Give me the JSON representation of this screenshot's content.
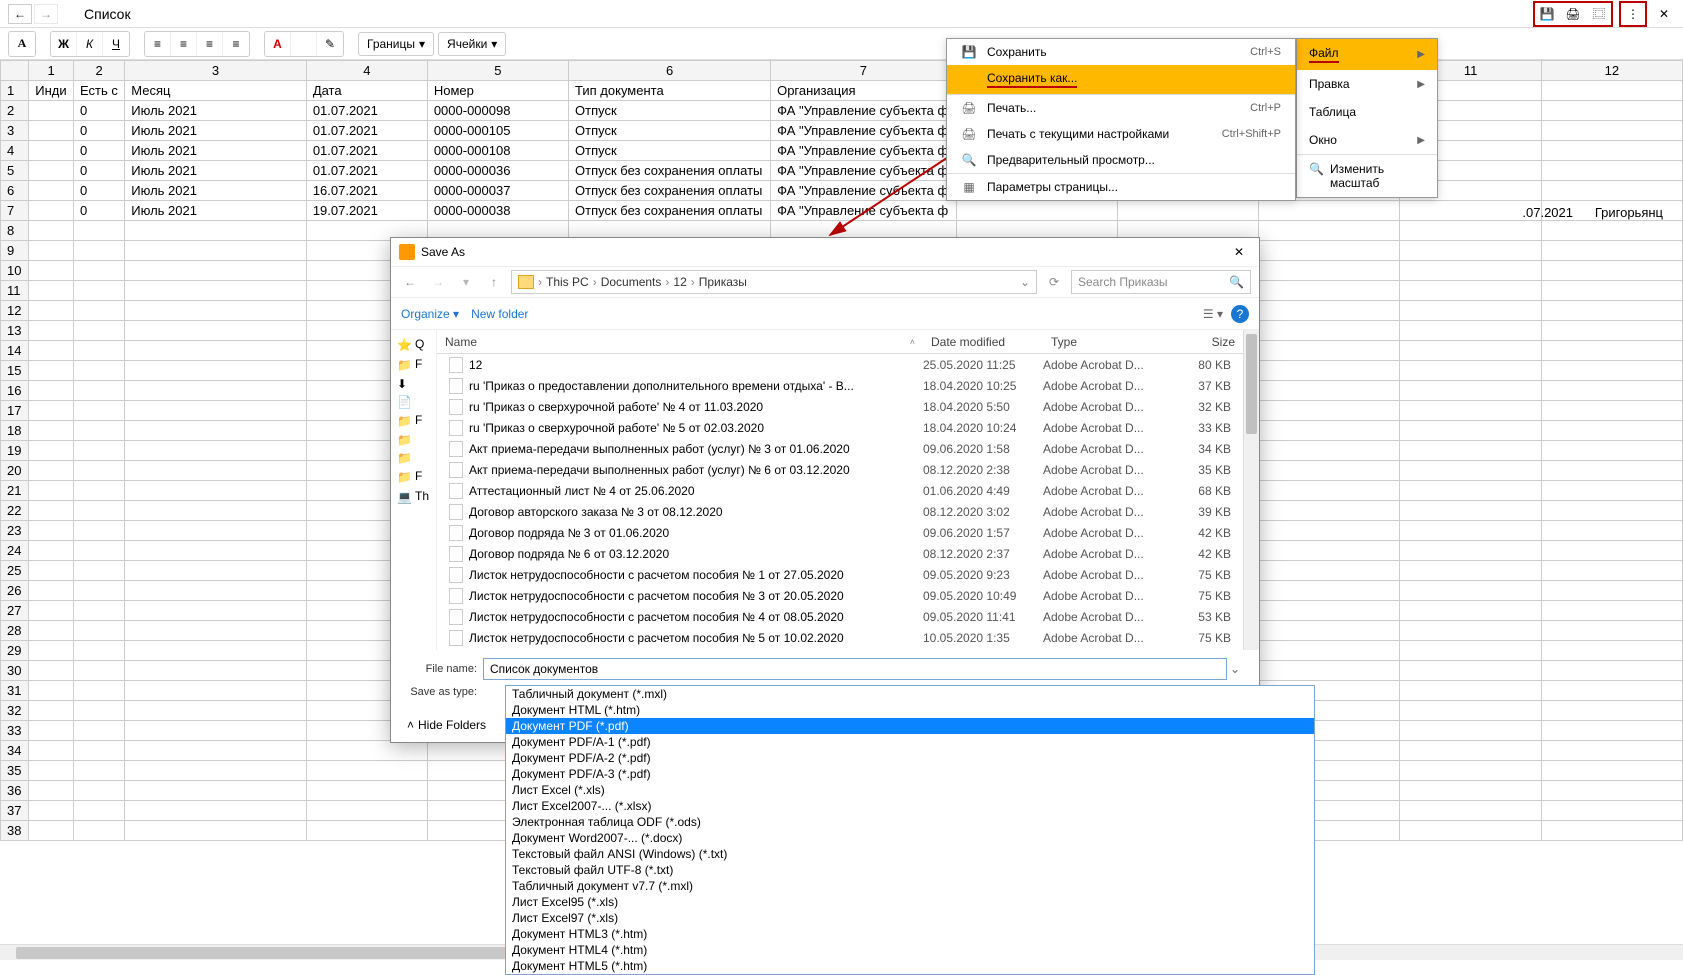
{
  "title": "Список",
  "topRightExtra1": ".07.2021",
  "topRightExtra2": "Григорьянц",
  "toolbar": {
    "font_label": "А",
    "bold": "Ж",
    "italic": "К",
    "underline": "Ч",
    "borders_label": "Границы",
    "cells_label": "Ячейки"
  },
  "mainMenu": {
    "file": "Файл",
    "edit": "Правка",
    "table": "Таблица",
    "window": "Окно",
    "zoom": "Изменить масштаб"
  },
  "fileMenu": {
    "save": "Сохранить",
    "save_sc": "Ctrl+S",
    "saveas": "Сохранить как...",
    "print": "Печать...",
    "print_sc": "Ctrl+P",
    "print_current": "Печать с текущими настройками",
    "print_current_sc": "Ctrl+Shift+P",
    "preview": "Предварительный просмотр...",
    "page_setup": "Параметры страницы..."
  },
  "sheet": {
    "headers": [
      "Инди",
      "Есть с",
      "Месяц",
      "Дата",
      "Номер",
      "Тип документа",
      "Организация"
    ],
    "rows": [
      [
        "",
        "0",
        "Июль 2021",
        "01.07.2021",
        "0000-000098",
        "Отпуск",
        "ФА \"Управление субъекта ф"
      ],
      [
        "",
        "0",
        "Июль 2021",
        "01.07.2021",
        "0000-000105",
        "Отпуск",
        "ФА \"Управление субъекта ф"
      ],
      [
        "",
        "0",
        "Июль 2021",
        "01.07.2021",
        "0000-000108",
        "Отпуск",
        "ФА \"Управление субъекта ф"
      ],
      [
        "",
        "0",
        "Июль 2021",
        "01.07.2021",
        "0000-000036",
        "Отпуск без сохранения оплаты",
        "ФА \"Управление субъекта ф"
      ],
      [
        "",
        "0",
        "Июль 2021",
        "16.07.2021",
        "0000-000037",
        "Отпуск без сохранения оплаты",
        "ФА \"Управление субъекта ф"
      ],
      [
        "",
        "0",
        "Июль 2021",
        "19.07.2021",
        "0000-000038",
        "Отпуск без сохранения оплаты",
        "ФА \"Управление субъекта ф"
      ]
    ]
  },
  "saveDialog": {
    "title": "Save As",
    "path": [
      "This PC",
      "Documents",
      "12",
      "Приказы"
    ],
    "search_ph": "Search Приказы",
    "organize": "Organize",
    "new_folder": "New folder",
    "cols": {
      "name": "Name",
      "date": "Date modified",
      "type": "Type",
      "size": "Size"
    },
    "files": [
      {
        "name": "12",
        "date": "25.05.2020 11:25",
        "type": "Adobe Acrobat D...",
        "size": "80 KB"
      },
      {
        "name": "ru 'Приказ о предоставлении дополнительного времени отдыха' - В...",
        "date": "18.04.2020 10:25",
        "type": "Adobe Acrobat D...",
        "size": "37 KB"
      },
      {
        "name": "ru 'Приказ о сверхурочной работе' № 4 от 11.03.2020",
        "date": "18.04.2020 5:50",
        "type": "Adobe Acrobat D...",
        "size": "32 KB"
      },
      {
        "name": "ru 'Приказ о сверхурочной работе' № 5 от 02.03.2020",
        "date": "18.04.2020 10:24",
        "type": "Adobe Acrobat D...",
        "size": "33 KB"
      },
      {
        "name": "Акт приема-передачи выполненных работ (услуг) № 3 от 01.06.2020",
        "date": "09.06.2020 1:58",
        "type": "Adobe Acrobat D...",
        "size": "34 KB"
      },
      {
        "name": "Акт приема-передачи выполненных работ (услуг) № 6 от 03.12.2020",
        "date": "08.12.2020 2:38",
        "type": "Adobe Acrobat D...",
        "size": "35 KB"
      },
      {
        "name": "Аттестационный лист № 4 от 25.06.2020",
        "date": "01.06.2020 4:49",
        "type": "Adobe Acrobat D...",
        "size": "68 KB"
      },
      {
        "name": "Договор авторского заказа № 3 от 08.12.2020",
        "date": "08.12.2020 3:02",
        "type": "Adobe Acrobat D...",
        "size": "39 KB"
      },
      {
        "name": "Договор подряда № 3 от 01.06.2020",
        "date": "09.06.2020 1:57",
        "type": "Adobe Acrobat D...",
        "size": "42 KB"
      },
      {
        "name": "Договор подряда № 6 от 03.12.2020",
        "date": "08.12.2020 2:37",
        "type": "Adobe Acrobat D...",
        "size": "42 KB"
      },
      {
        "name": "Листок нетрудоспособности с расчетом пособия № 1 от 27.05.2020",
        "date": "09.05.2020 9:23",
        "type": "Adobe Acrobat D...",
        "size": "75 KB"
      },
      {
        "name": "Листок нетрудоспособности с расчетом пособия № 3 от 20.05.2020",
        "date": "09.05.2020 10:49",
        "type": "Adobe Acrobat D...",
        "size": "75 KB"
      },
      {
        "name": "Листок нетрудоспособности с расчетом пособия № 4 от 08.05.2020",
        "date": "09.05.2020 11:41",
        "type": "Adobe Acrobat D...",
        "size": "53 KB"
      },
      {
        "name": "Листок нетрудоспособности с расчетом пособия № 5 от 10.02.2020",
        "date": "10.05.2020 1:35",
        "type": "Adobe Acrobat D...",
        "size": "75 KB"
      }
    ],
    "filename_label": "File name:",
    "filename_value": "Список документов",
    "saveastype_label": "Save as type:",
    "hide_folders": "Hide Folders",
    "formats": [
      "Табличный документ (*.mxl)",
      "Документ HTML (*.htm)",
      "Документ PDF (*.pdf)",
      "Документ PDF/A-1 (*.pdf)",
      "Документ PDF/A-2 (*.pdf)",
      "Документ PDF/A-3 (*.pdf)",
      "Лист Excel (*.xls)",
      "Лист Excel2007-... (*.xlsx)",
      "Электронная таблица ODF (*.ods)",
      "Документ Word2007-... (*.docx)",
      "Текстовый файл ANSI (Windows) (*.txt)",
      "Текстовый файл UTF-8 (*.txt)",
      "Табличный документ v7.7 (*.mxl)",
      "Лист Excel95 (*.xls)",
      "Лист Excel97 (*.xls)",
      "Документ HTML3 (*.htm)",
      "Документ HTML4 (*.htm)",
      "Документ HTML5 (*.htm)"
    ],
    "selected_format_index": 2
  },
  "sidebar_items": [
    "Q",
    "F",
    "",
    "",
    "F",
    "",
    "",
    "F",
    "Th"
  ]
}
